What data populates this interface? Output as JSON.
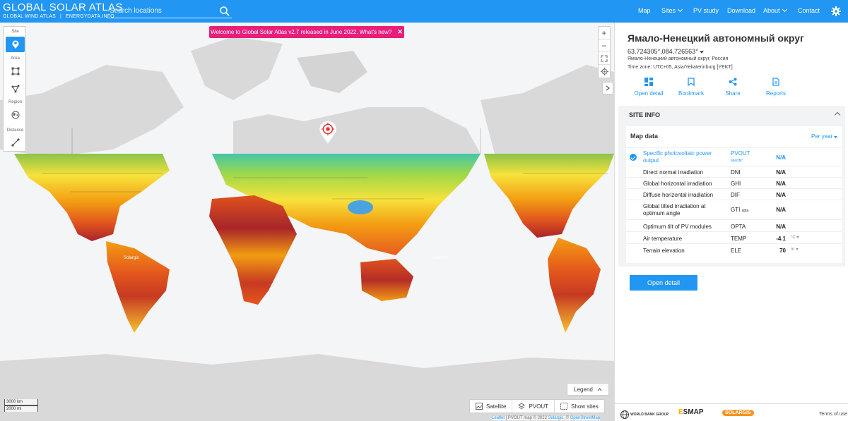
{
  "brand": {
    "title": "GLOBAL SOLAR ATLAS",
    "sub_left": "GLOBAL WIND ATLAS",
    "sub_sep": "|",
    "sub_right": "ENERGYDATA.INFO"
  },
  "search": {
    "placeholder": "Search locations",
    "icon": "search-icon"
  },
  "nav": {
    "map": "Map",
    "sites": "Sites",
    "pv_study": "PV study",
    "download": "Download",
    "about": "About",
    "contact": "Contact",
    "settings_icon": "gear-icon"
  },
  "tools": {
    "site_label": "Site",
    "area_label": "Area",
    "region_label": "Region",
    "distance_label": "Distance"
  },
  "welcome": {
    "text": "Welcome to Global Solar Atlas v2.7 released in June 2022. What's new?",
    "close": "✕"
  },
  "map": {
    "watermark": "Solargis",
    "legend": "Legend",
    "layers": {
      "satellite": "Satellite",
      "pvout": "PVOUT",
      "show_sites": "Show sites"
    },
    "scale": {
      "km": "3000 km",
      "mi": "2000 mi"
    },
    "attribution": {
      "leaflet": "Leaflet",
      "mid": " | PVOUT map © 2022 ",
      "solargis": "Solargis",
      "sep": ", © ",
      "osm": "OpenStreetMap"
    },
    "zoom_in": "+",
    "zoom_out": "−"
  },
  "site": {
    "title": "Ямало-Ненецкий автономный округ",
    "coords": "63.724305°,084.726563°",
    "location": "Ямало-Ненецкий автономный округ, Россия",
    "timezone": "Time zone: UTC+05, Asia/Yekaterinburg [YEKT]",
    "actions": {
      "open_detail": "Open detail",
      "bookmark": "Bookmark",
      "share": "Share",
      "reports": "Reports"
    }
  },
  "site_info": {
    "heading": "SITE INFO",
    "map_data_title": "Map data",
    "period": "Per year",
    "rows": [
      {
        "name": "Specific photovoltaic power output",
        "abbr": "PVOUT",
        "abbr_sub": "specific",
        "value": "N/A",
        "unit": "",
        "selected": true
      },
      {
        "name": "Direct normal irradiation",
        "abbr": "DNI",
        "abbr_sub": "",
        "value": "N/A",
        "unit": ""
      },
      {
        "name": "Global horizontal irradiation",
        "abbr": "GHI",
        "abbr_sub": "",
        "value": "N/A",
        "unit": ""
      },
      {
        "name": "Diffuse horizontal irradiation",
        "abbr": "DIF",
        "abbr_sub": "",
        "value": "N/A",
        "unit": ""
      },
      {
        "name": "Global tilted irradiation at optimum angle",
        "abbr": "GTI",
        "abbr_sub": "opta",
        "value": "N/A",
        "unit": ""
      },
      {
        "name": "Optimum tilt of PV modules",
        "abbr": "OPTA",
        "abbr_sub": "",
        "value": "N/A",
        "unit": ""
      },
      {
        "name": "Air temperature",
        "abbr": "TEMP",
        "abbr_sub": "",
        "value": "-4.1",
        "unit": "°C"
      },
      {
        "name": "Terrain elevation",
        "abbr": "ELE",
        "abbr_sub": "",
        "value": "70",
        "unit": "m"
      }
    ],
    "open_detail_button": "Open detail"
  },
  "footer": {
    "world_bank": "WORLD BANK GROUP",
    "esmap_e": "E",
    "esmap_rest": "SMAP",
    "solargis": "SOLARGIS",
    "terms": "Terms of use"
  },
  "colors": {
    "primary": "#2196f3",
    "welcome": "#e91e7a",
    "marker": "#e53935"
  }
}
